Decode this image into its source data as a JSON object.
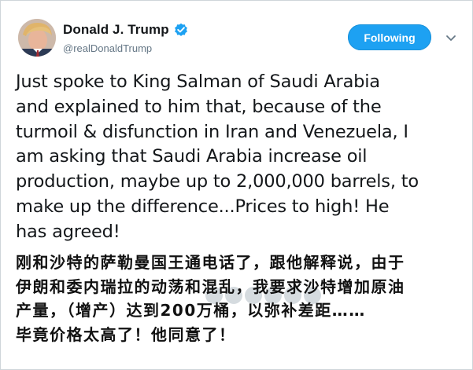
{
  "tweet": {
    "display_name": "Donald J. Trump",
    "handle": "@realDonaldTrump",
    "follow_label": "Following",
    "text": "Just spoke to King Salman of Saudi Arabia\nand explained to him that, because of the\nturmoil & disfunction in Iran and Venezuela, I\nam asking that Saudi Arabia increase oil\nproduction, maybe up to 2,000,000 barrels, to\nmake up the difference...Prices to high! He\nhas agreed!"
  },
  "translation": {
    "lines": [
      "刚和沙特的萨勒曼国王通电话了，跟他解释说，由于",
      "伊朗和委内瑞拉的动荡和混乱，我要求沙特增加原油",
      "产量，（增产）达到200万桶，以弥补差距……",
      "毕竟价格太高了！他同意了！"
    ]
  },
  "colors": {
    "accent": "#1da1f2",
    "handle": "#657786",
    "text": "#14171a"
  },
  "icons": {
    "verified": "verified-badge-icon",
    "menu": "chevron-down-icon"
  }
}
